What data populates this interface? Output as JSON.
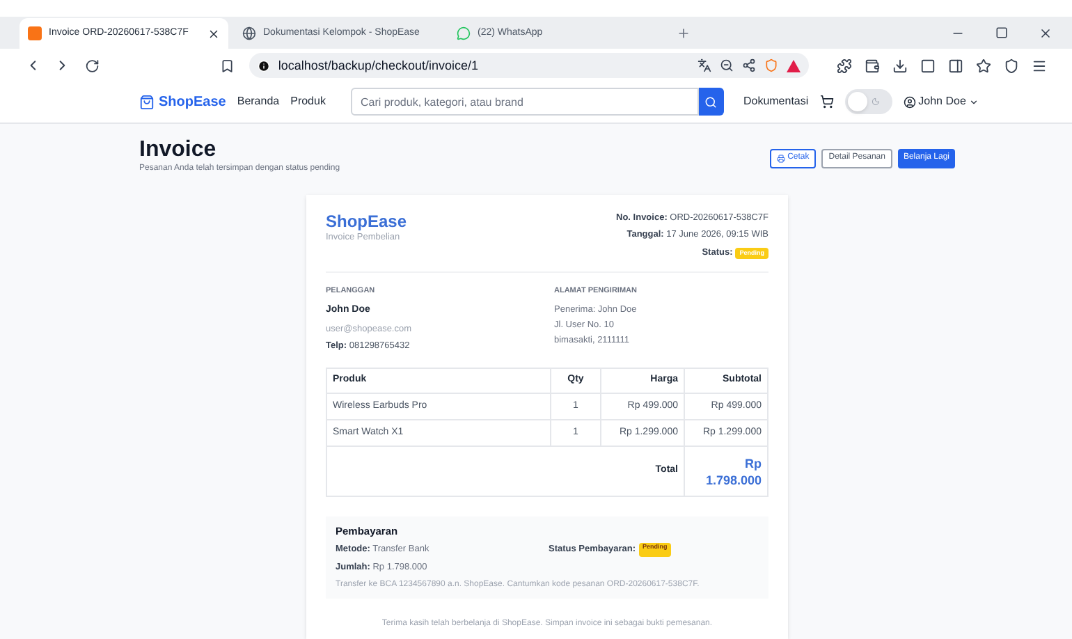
{
  "browser": {
    "tabs": [
      {
        "title": "Invoice ORD-20260617-538C7F",
        "selected": true,
        "kind": "app"
      },
      {
        "title": "Dokumentasi Kelompok - ShopEase",
        "selected": false,
        "kind": "globe"
      },
      {
        "title": "(22) WhatsApp",
        "selected": false,
        "kind": "chat"
      }
    ],
    "url": "localhost/backup/checkout/invoice/1"
  },
  "navbar": {
    "brand": "ShopEase",
    "links": [
      "Beranda",
      "Produk"
    ],
    "search": {
      "placeholder": "Cari produk, kategori, atau brand"
    },
    "docs": "Dokumentasi",
    "dark_mode": {
      "on": false
    },
    "user": "John Doe"
  },
  "header": {
    "title": "Invoice",
    "subtitle": "Pesanan Anda telah tersimpan dengan status pending",
    "buttons": [
      {
        "label": "Cetak",
        "kind": "outline"
      },
      {
        "label": "Detail Pesanan",
        "kind": "plain"
      },
      {
        "label": "Belanja Lagi",
        "kind": "primary"
      }
    ]
  },
  "invoice": {
    "brand": "ShopEase",
    "brand_sub": "Invoice Pembelian",
    "meta": [
      {
        "label": "No. Invoice:",
        "value": "ORD-20260617-538C7F"
      },
      {
        "label": "Tanggal:",
        "value": "17 June 2026, 09:15 WIB"
      }
    ],
    "status": {
      "label": "Status:",
      "badge": "Pending"
    },
    "customer": {
      "heading": "PELANGGAN",
      "name": "John Doe",
      "email": "user@shopease.com",
      "phone_label": "Telp:",
      "phone": "081298765432"
    },
    "shipping": {
      "heading": "ALAMAT PENGIRIMAN",
      "lines": [
        "Penerima: John Doe",
        "Jl. User No. 10",
        "bimasakti, 2111111"
      ]
    },
    "table": {
      "columns": [
        "Produk",
        "Qty",
        "Harga",
        "Subtotal"
      ],
      "rows": [
        [
          "Wireless Earbuds Pro",
          "1",
          "Rp 499.000",
          "Rp 499.000"
        ],
        [
          "Smart Watch X1",
          "1",
          "Rp 1.299.000",
          "Rp 1.299.000"
        ]
      ],
      "total_label": "Total",
      "total_value": [
        "Rp",
        "1.798.000"
      ]
    },
    "payment": {
      "heading": "Pembayaran",
      "method_label": "Metode:",
      "method": "Transfer Bank",
      "status_label": "Status Pembayaran:",
      "status_badge": "Pending",
      "amount_label": "Jumlah:",
      "amount": "Rp 1.798.000",
      "note": "Transfer ke BCA 1234567890 a.n. ShopEase. Cantumkan kode pesanan ORD-20260617-538C7F."
    },
    "footer": "Terima kasih telah berbelanja di ShopEase. Simpan invoice ini sebagai bukti pemesanan."
  }
}
